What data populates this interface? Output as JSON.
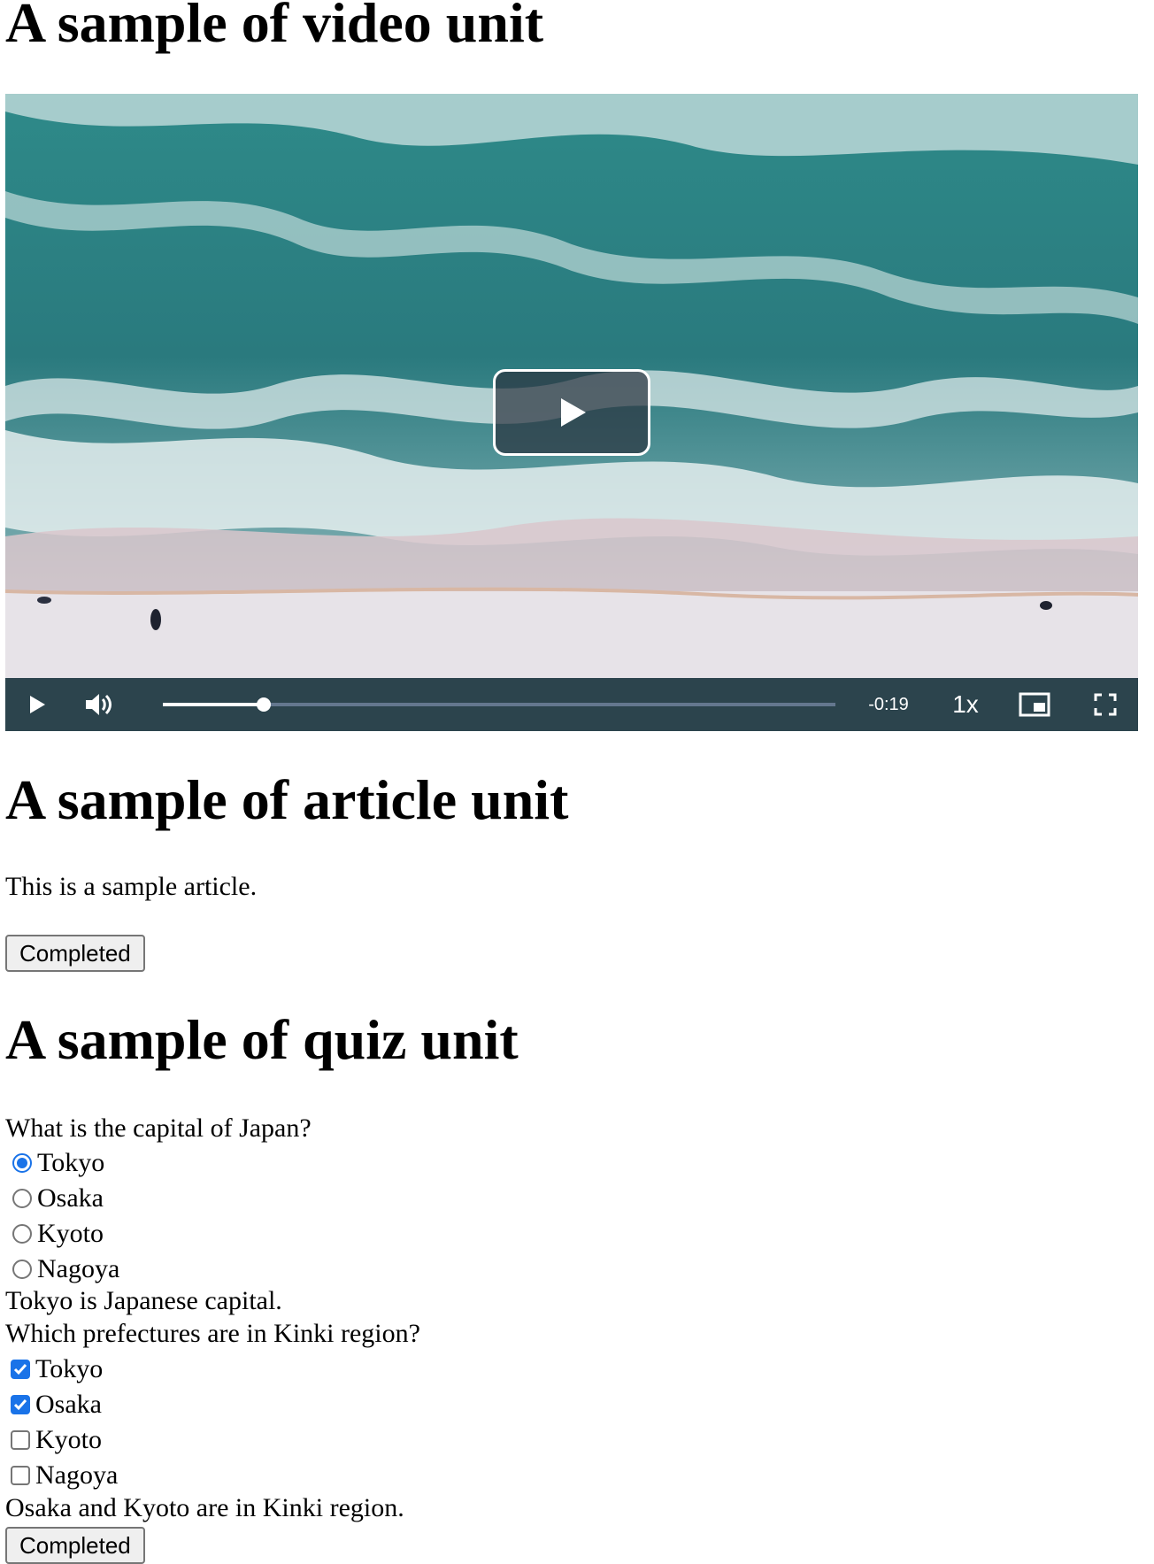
{
  "video_section": {
    "heading": "A sample of video unit",
    "player": {
      "time_remaining": "-0:19",
      "playback_rate": "1x",
      "progress_fraction": 0.15,
      "icons": [
        "big-play-icon",
        "play-icon",
        "volume-icon",
        "picture-in-picture-icon",
        "fullscreen-icon"
      ]
    }
  },
  "article_section": {
    "heading": "A sample of article unit",
    "body": "This is a sample article.",
    "button_label": "Completed"
  },
  "quiz_section": {
    "heading": "A sample of quiz unit",
    "questions": [
      {
        "prompt": "What is the capital of Japan?",
        "type": "radio",
        "options": [
          {
            "label": "Tokyo",
            "selected": true
          },
          {
            "label": "Osaka",
            "selected": false
          },
          {
            "label": "Kyoto",
            "selected": false
          },
          {
            "label": "Nagoya",
            "selected": false
          }
        ],
        "explanation": "Tokyo is Japanese capital."
      },
      {
        "prompt": "Which prefectures are in Kinki region?",
        "type": "checkbox",
        "options": [
          {
            "label": "Tokyo",
            "selected": true
          },
          {
            "label": "Osaka",
            "selected": true
          },
          {
            "label": "Kyoto",
            "selected": false
          },
          {
            "label": "Nagoya",
            "selected": false
          }
        ],
        "explanation": "Osaka and Kyoto are in Kinki region."
      }
    ],
    "button_label": "Completed"
  },
  "colors": {
    "accent": "#1a73e8",
    "control_bar": "#2b333f",
    "sea": "#2f7f82",
    "sand": "#e7e3e8"
  }
}
